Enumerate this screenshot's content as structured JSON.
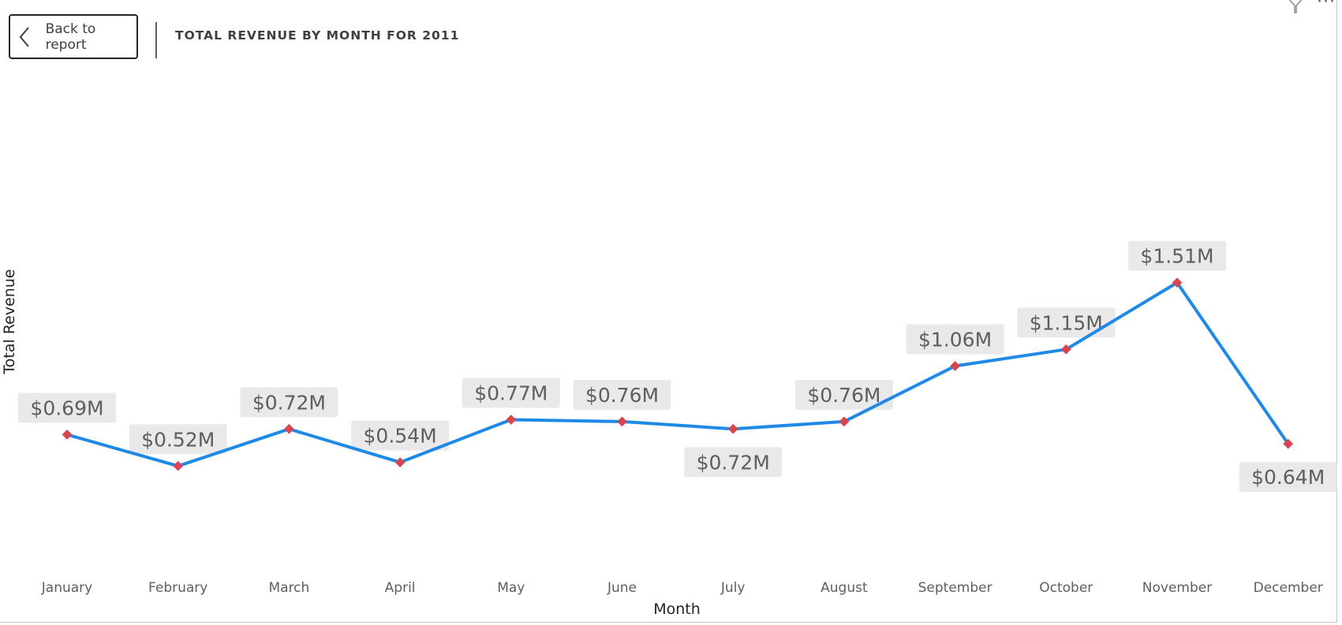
{
  "header": {
    "back_label": "Back to report",
    "title": "TOTAL REVENUE BY MONTH FOR 2011",
    "more_glyph": "···"
  },
  "colors": {
    "line": "#1f8ae5",
    "marker": "#d64550",
    "label_bg": "#e9e9e9"
  },
  "icons": [
    "chevron-left-icon",
    "filter-icon",
    "more-options-icon"
  ],
  "chart_data": {
    "type": "line",
    "title": "TOTAL REVENUE BY MONTH FOR 2011",
    "xlabel": "Month",
    "ylabel": "Total Revenue",
    "categories": [
      "January",
      "February",
      "March",
      "April",
      "May",
      "June",
      "July",
      "August",
      "September",
      "October",
      "November",
      "December"
    ],
    "values": [
      0.69,
      0.52,
      0.72,
      0.54,
      0.77,
      0.76,
      0.72,
      0.76,
      1.06,
      1.15,
      1.51,
      0.64
    ],
    "value_labels": [
      "$0.69M",
      "$0.52M",
      "$0.72M",
      "$0.54M",
      "$0.77M",
      "$0.76M",
      "$0.72M",
      "$0.76M",
      "$1.06M",
      "$1.15M",
      "$1.51M",
      "$0.64M"
    ],
    "value_unit": "$M",
    "grid": false,
    "legend": "none"
  }
}
